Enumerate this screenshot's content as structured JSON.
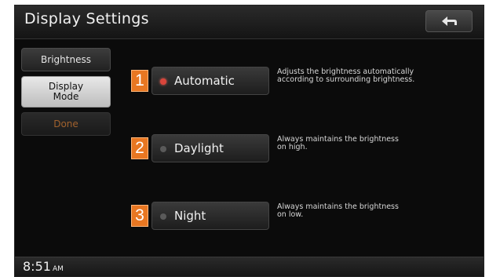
{
  "window": {
    "title": "Display Settings",
    "back_icon": "return-arrow-icon"
  },
  "sidebar": {
    "items": [
      {
        "label": "Brightness",
        "state": "normal"
      },
      {
        "label_line1": "Display",
        "label_line2": "Mode",
        "state": "selected"
      },
      {
        "label": "Done",
        "state": "disabled"
      }
    ]
  },
  "options": [
    {
      "number": "1",
      "label": "Automatic",
      "selected": true,
      "desc_line1": "Adjusts the brightness automatically",
      "desc_line2": "according to surrounding brightness."
    },
    {
      "number": "2",
      "label": "Daylight",
      "selected": false,
      "desc_line1": "Always maintains the brightness",
      "desc_line2": "on high."
    },
    {
      "number": "3",
      "label": "Night",
      "selected": false,
      "desc_line1": "Always maintains the brightness",
      "desc_line2": "on low."
    }
  ],
  "status": {
    "time": "8:51",
    "ampm": "AM"
  },
  "colors": {
    "callout_badge": "#e87722",
    "radio_active": "#d9453b",
    "done_text": "#a0612d"
  }
}
